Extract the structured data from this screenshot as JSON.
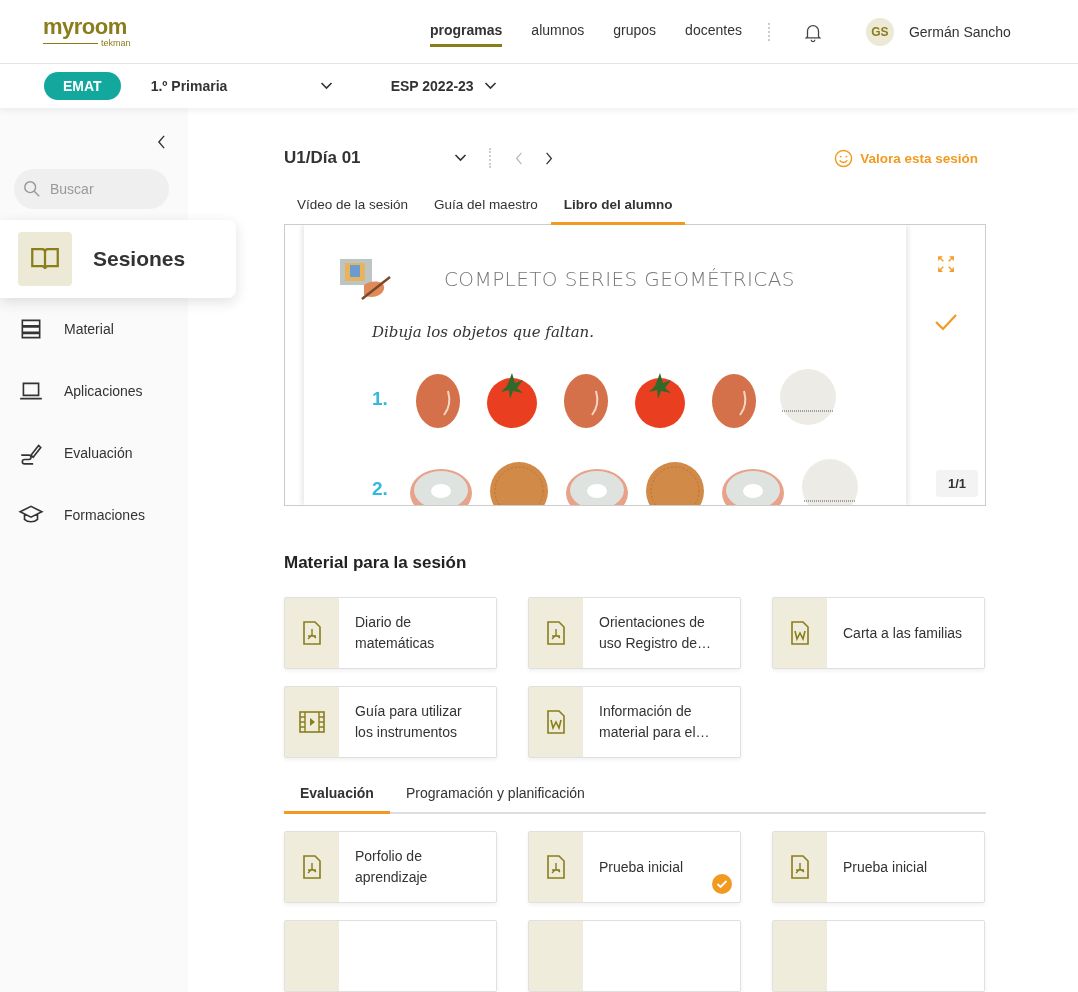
{
  "header": {
    "logo": "myroom",
    "logo_sub": "tekman",
    "nav": [
      {
        "label": "programas",
        "selected": true
      },
      {
        "label": "alumnos",
        "selected": false
      },
      {
        "label": "grupos",
        "selected": false
      },
      {
        "label": "docentes",
        "selected": false
      }
    ],
    "user": {
      "initials": "GS",
      "name": "Germán Sancho"
    }
  },
  "subheader": {
    "program": "EMAT",
    "course": "1.º Primaria",
    "year": "ESP 2022-23"
  },
  "sidebar": {
    "search": {
      "placeholder": "Buscar"
    },
    "items": [
      {
        "label": "Sesiones",
        "kind": "book",
        "selected": true
      },
      {
        "label": "Material",
        "kind": "stack",
        "selected": false
      },
      {
        "label": "Aplicaciones",
        "kind": "laptop",
        "selected": false
      },
      {
        "label": "Evaluación",
        "kind": "pen",
        "selected": false
      },
      {
        "label": "Formaciones",
        "kind": "cap",
        "selected": false
      }
    ]
  },
  "session": {
    "title": "U1/Día 01",
    "rate": "Valora esta sesión"
  },
  "tabs": [
    {
      "label": "Vídeo de la sesión",
      "selected": false
    },
    {
      "label": "Guía del maestro",
      "selected": false
    },
    {
      "label": "Libro del alumno",
      "selected": true
    }
  ],
  "worksheet": {
    "title": "COMPLETO SERIES GEOMÉTRICAS",
    "instruction": "Dibuja los objetos que faltan.",
    "rows": [
      {
        "number": "1.",
        "items": [
          {
            "kind": "egg"
          },
          {
            "kind": "tomato"
          },
          {
            "kind": "egg"
          },
          {
            "kind": "tomato"
          },
          {
            "kind": "egg"
          },
          {
            "kind": "blank"
          }
        ]
      },
      {
        "number": "2.",
        "items": [
          {
            "kind": "donut"
          },
          {
            "kind": "cookie"
          },
          {
            "kind": "donut"
          },
          {
            "kind": "cookie"
          },
          {
            "kind": "donut"
          },
          {
            "kind": "blank"
          }
        ]
      }
    ],
    "page": "1/1",
    "done": true
  },
  "materials": {
    "title": "Material para la sesión",
    "cards": [
      {
        "title": "Diario de matemáticas",
        "kind": "pdf"
      },
      {
        "title": "Orientaciones de uso Registro de…",
        "kind": "pdf"
      },
      {
        "title": "Carta a las familias",
        "kind": "word"
      },
      {
        "title": "Guía para utilizar los instrumentos",
        "kind": "video"
      },
      {
        "title": "Información de material para el…",
        "kind": "word"
      }
    ]
  },
  "subtabs": [
    {
      "label": "Evaluación",
      "selected": true
    },
    {
      "label": "Programación y planificación",
      "selected": false
    }
  ],
  "eval_cards": [
    {
      "kind": "pdf",
      "title": "Porfolio de aprendizaje",
      "done": false
    },
    {
      "kind": "pdf",
      "title": "Prueba inicial",
      "done": true
    },
    {
      "kind": "pdf",
      "title": "Prueba inicial",
      "done": false
    },
    {
      "kind": "partial"
    },
    {
      "kind": "partial"
    },
    {
      "kind": "partial"
    }
  ]
}
